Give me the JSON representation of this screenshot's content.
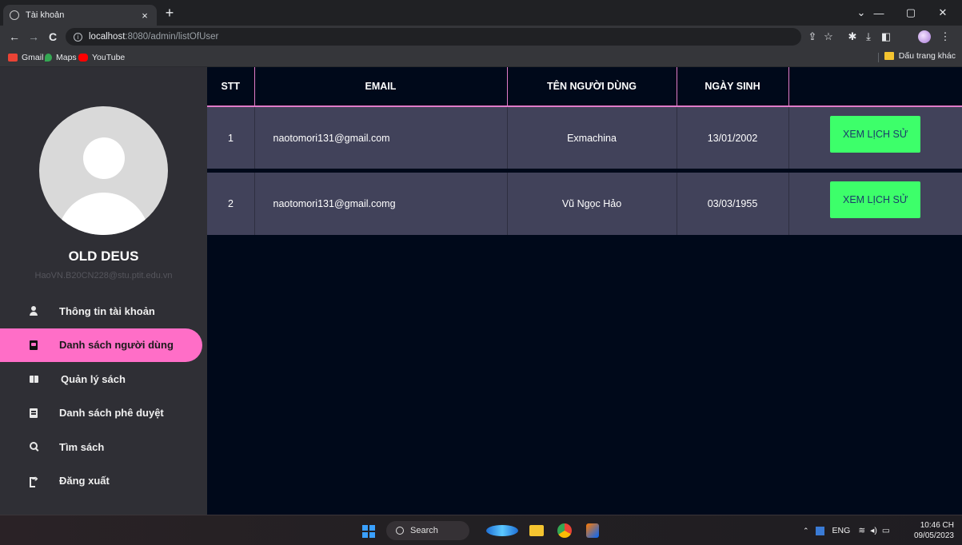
{
  "browser": {
    "tab_title": "Tài khoản",
    "tab_close": "×",
    "new_tab": "+",
    "url_host": "localhost",
    "url_path": ":8080/admin/listOfUser",
    "back": "←",
    "forward": "→",
    "reload": "C",
    "bookmarks": [
      {
        "label": "Gmail",
        "color": "#ea4335"
      },
      {
        "label": "Maps",
        "color": "#34a853"
      },
      {
        "label": "YouTube",
        "color": "#ff0000"
      }
    ],
    "other_bookmarks": "Dấu trang khác"
  },
  "sidebar": {
    "user_name": "OLD DEUS",
    "user_email": "HaoVN.B20CN228@stu.ptit.edu.vn",
    "menu": [
      {
        "label": "Thông tin tài khoản",
        "icon": "user-icon",
        "active": false
      },
      {
        "label": "Danh sách người dùng",
        "icon": "address-book-icon",
        "active": true
      },
      {
        "label": "Quản lý sách",
        "icon": "open-book-icon",
        "active": false
      },
      {
        "label": "Danh sách phê duyệt",
        "icon": "list-icon",
        "active": false
      },
      {
        "label": "Tìm sách",
        "icon": "search-icon",
        "active": false
      },
      {
        "label": "Đăng xuất",
        "icon": "logout-icon",
        "active": false
      }
    ]
  },
  "table": {
    "headers": [
      "STT",
      "EMAIL",
      "TÊN NGƯỜI DÙNG",
      "NGÀY SINH",
      ""
    ],
    "rows": [
      {
        "stt": "1",
        "email": "naotomori131@gmail.com",
        "name": "Exmachina",
        "dob": "13/01/2002",
        "action": "XEM LỊCH SỬ"
      },
      {
        "stt": "2",
        "email": "naotomori131@gmail.comg",
        "name": "Vũ Ngọc Hảo",
        "dob": "03/03/1955",
        "action": "XEM LỊCH SỬ"
      }
    ]
  },
  "taskbar": {
    "search_label": "Search",
    "lang": "ENG",
    "time": "10:46 CH",
    "date": "09/05/2023"
  },
  "colors": {
    "accent_pink": "#ff6ec7",
    "button_green": "#3dff6a",
    "sidebar_bg": "#2f2f35",
    "page_bg": "#00091a",
    "row_bg": "#41425a"
  }
}
